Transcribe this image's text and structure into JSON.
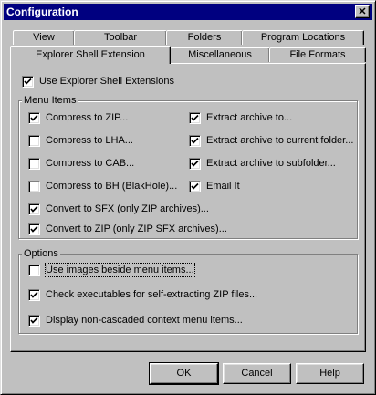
{
  "window": {
    "title": "Configuration"
  },
  "tabs": {
    "row1": [
      "View",
      "Toolbar",
      "Folders",
      "Program Locations"
    ],
    "row2": [
      "Explorer Shell Extension",
      "Miscellaneous",
      "File Formats"
    ]
  },
  "panel": {
    "use_shell_ext": {
      "label": "Use Explorer Shell Extensions",
      "checked": true
    },
    "menu_items": {
      "title": "Menu Items",
      "left": [
        {
          "label": "Compress to ZIP...",
          "checked": true
        },
        {
          "label": "Compress to LHA...",
          "checked": false
        },
        {
          "label": "Compress to CAB...",
          "checked": false
        },
        {
          "label": "Compress to BH (BlakHole)...",
          "checked": false
        },
        {
          "label": "Convert to SFX (only ZIP archives)...",
          "checked": true
        },
        {
          "label": "Convert to ZIP (only ZIP SFX archives)...",
          "checked": true
        }
      ],
      "right": [
        {
          "label": "Extract archive to...",
          "checked": true
        },
        {
          "label": "Extract archive to current folder...",
          "checked": true
        },
        {
          "label": "Extract archive to subfolder...",
          "checked": true
        },
        {
          "label": "Email It",
          "checked": true
        }
      ]
    },
    "options": {
      "title": "Options",
      "items": [
        {
          "label": "Use images beside menu items...",
          "checked": false
        },
        {
          "label": "Check executables for self-extracting ZIP files...",
          "checked": true
        },
        {
          "label": "Display non-cascaded context menu items...",
          "checked": true
        }
      ]
    }
  },
  "buttons": {
    "ok": "OK",
    "cancel": "Cancel",
    "help": "Help"
  }
}
